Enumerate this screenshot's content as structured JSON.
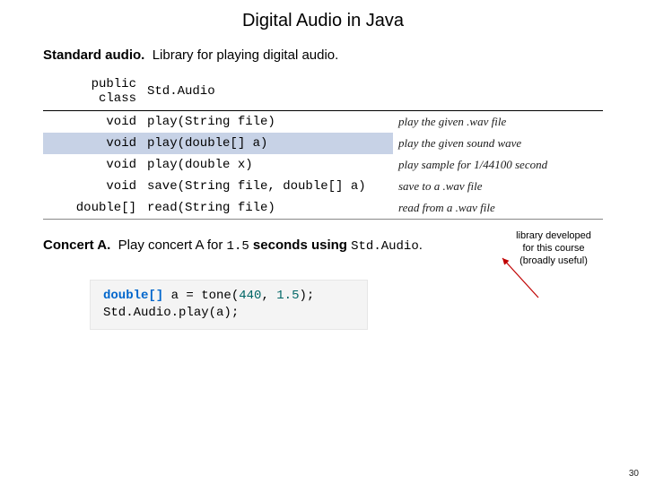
{
  "title": "Digital Audio in Java",
  "standard": {
    "label": "Standard audio.",
    "desc": "Library for playing digital audio."
  },
  "api": {
    "class_kw": "public class",
    "class_name": "Std.Audio",
    "rows": [
      {
        "ret": "void",
        "sig": "play(String file)",
        "desc": "play the given .wav file",
        "hi": false
      },
      {
        "ret": "void",
        "sig": "play(double[] a)",
        "desc": "play the given sound wave",
        "hi": true
      },
      {
        "ret": "void",
        "sig": "play(double x)",
        "desc": "play sample for 1/44100 second",
        "hi": false
      },
      {
        "ret": "void",
        "sig": "save(String file, double[] a)",
        "desc": "save to a .wav file",
        "hi": false
      },
      {
        "ret": "double[]",
        "sig": "read(String file)",
        "desc": "read from a .wav file",
        "hi": false
      }
    ]
  },
  "concert": {
    "label": "Concert A.",
    "desc_a": "Play concert A for ",
    "duration": "1.5",
    "desc_b": " seconds using ",
    "lib": "Std.Audio",
    "period": "."
  },
  "note": {
    "l1": "library developed",
    "l2": "for this course",
    "l3": "(broadly useful)"
  },
  "code": {
    "l1_a": "double[]",
    "l1_b": " a = tone(",
    "l1_c": "440",
    "l1_d": ", ",
    "l1_e": "1.5",
    "l1_f": ");",
    "l2_a": "Std.Audio.play(a);"
  },
  "page": "30"
}
